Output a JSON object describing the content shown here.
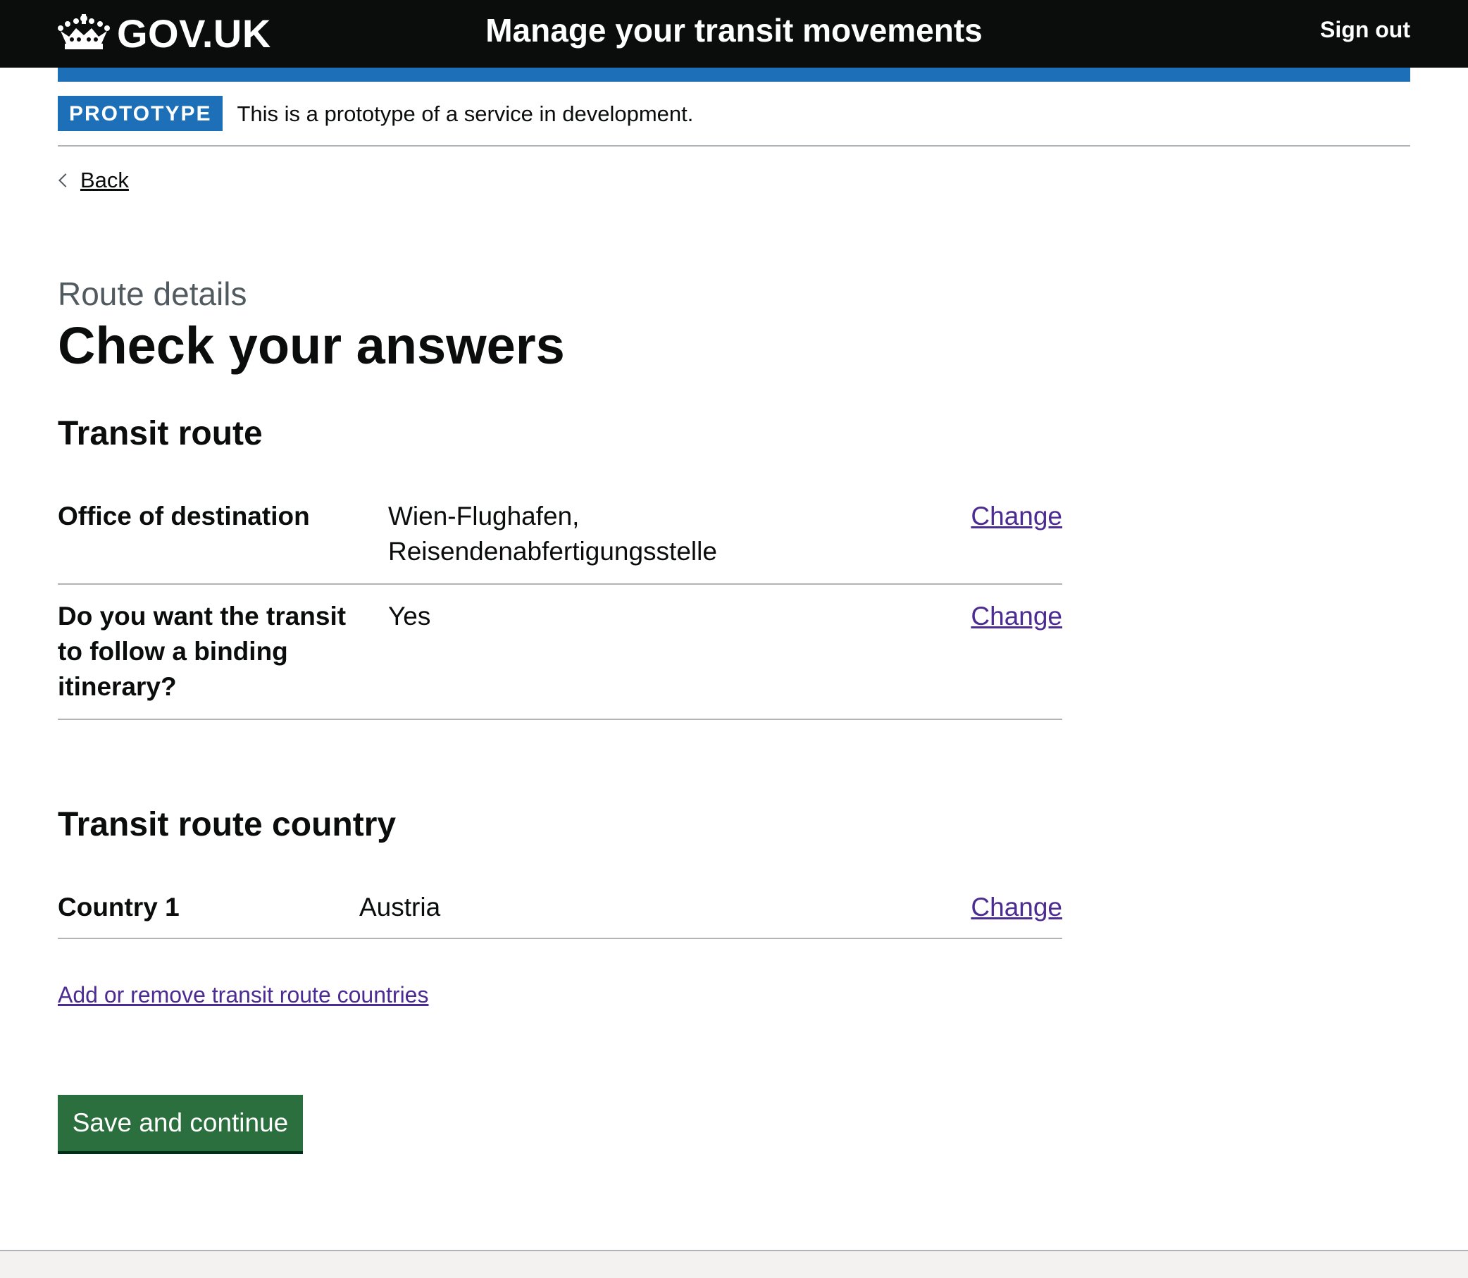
{
  "header": {
    "logo_text": "GOV.UK",
    "service_name": "Manage your transit movements",
    "sign_out": "Sign out"
  },
  "phase_banner": {
    "tag": "PROTOTYPE",
    "text": "This is a prototype of a service in development."
  },
  "back_link": "Back",
  "caption": "Route details",
  "title": "Check your answers",
  "sections": [
    {
      "heading": "Transit route",
      "rows": [
        {
          "key": "Office of destination",
          "value_line1": "Wien-Flughafen,",
          "value_line2": "Reisendenabfertigungsstelle",
          "action": "Change"
        },
        {
          "key_line1": "Do you want the transit",
          "key_line2": "to follow a binding",
          "key_line3": "itinerary?",
          "value": "Yes",
          "action": "Change"
        }
      ]
    },
    {
      "heading": "Transit route country",
      "rows": [
        {
          "key": "Country 1",
          "value": "Austria",
          "action": "Change"
        }
      ]
    }
  ],
  "add_remove_link": "Add or remove transit route countries",
  "submit_button": "Save and continue",
  "colors": {
    "header_bg": "#0b0c0c",
    "header_accent": "#1d70b8",
    "link": "#4c2c92",
    "button": "#2b6f3e"
  },
  "icons": {
    "logo": "crown-icon",
    "back": "chevron-left-icon"
  }
}
